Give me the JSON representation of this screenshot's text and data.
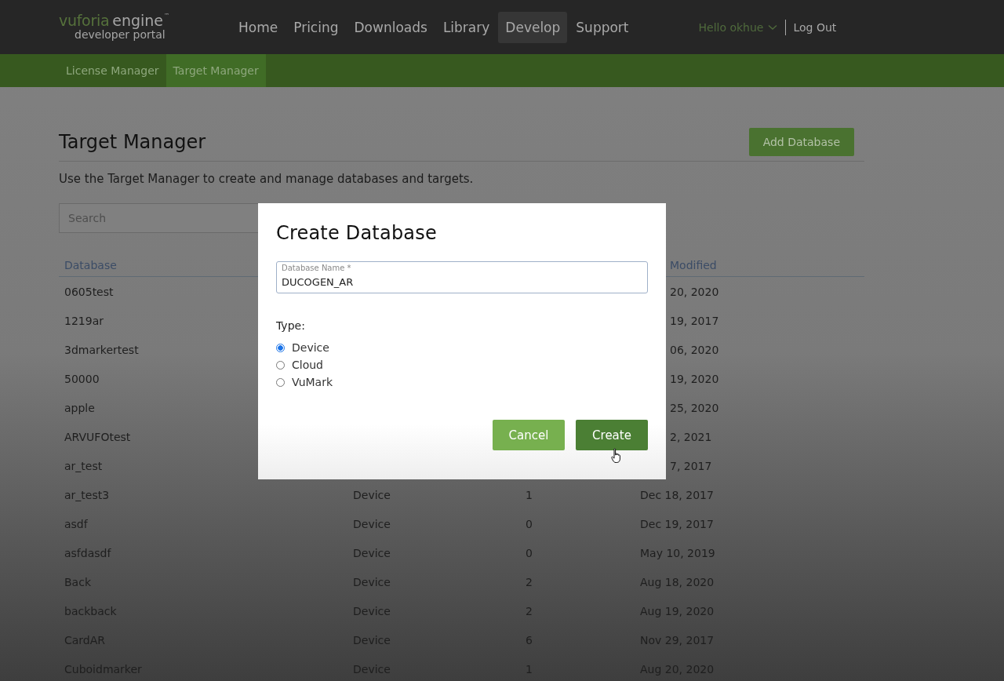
{
  "header": {
    "logo": {
      "brand": "vuforia",
      "product": "engine",
      "mark": "™",
      "subtitle": "developer portal"
    },
    "nav": [
      {
        "label": "Home",
        "selected": false
      },
      {
        "label": "Pricing",
        "selected": false
      },
      {
        "label": "Downloads",
        "selected": false
      },
      {
        "label": "Library",
        "selected": false
      },
      {
        "label": "Develop",
        "selected": true
      },
      {
        "label": "Support",
        "selected": false
      }
    ],
    "user": "Hello okhue",
    "logout": "Log Out"
  },
  "subnav": [
    {
      "label": "License Manager",
      "selected": false
    },
    {
      "label": "Target Manager",
      "selected": true
    }
  ],
  "page": {
    "title": "Target Manager",
    "add_button": "Add Database",
    "description": "Use the Target Manager to create and manage databases and targets.",
    "search": {
      "placeholder": "Search"
    }
  },
  "table": {
    "columns": [
      {
        "label": "Database",
        "covered": false
      },
      {
        "label": "Modified",
        "covered": true
      }
    ],
    "rows": [
      {
        "database": "0605test",
        "modified": "20, 2020"
      },
      {
        "database": "1219ar",
        "modified": "19, 2017"
      },
      {
        "database": "3dmarkertest",
        "modified": "06, 2020"
      },
      {
        "database": "50000",
        "modified": "19, 2020"
      },
      {
        "database": "apple",
        "modified": "25, 2020"
      },
      {
        "database": "ARVUFOtest",
        "modified": "2, 2021"
      },
      {
        "database": "ar_test",
        "modified": "7, 2017"
      },
      {
        "database": "ar_test3",
        "type": "Device",
        "targets": "1",
        "modified": "Dec 18, 2017"
      },
      {
        "database": "asdf",
        "type": "Device",
        "targets": "0",
        "modified": "Dec 19, 2017"
      },
      {
        "database": "asfdasdf",
        "type": "Device",
        "targets": "0",
        "modified": "May 10, 2019"
      },
      {
        "database": "Back",
        "type": "Device",
        "targets": "2",
        "modified": "Aug 18, 2020"
      },
      {
        "database": "backback",
        "type": "Device",
        "targets": "2",
        "modified": "Aug 19, 2020"
      },
      {
        "database": "CardAR",
        "type": "Device",
        "targets": "6",
        "modified": "Nov 29, 2017"
      },
      {
        "database": "Cuboidmarker",
        "type": "Device",
        "targets": "1",
        "modified": "Aug 20, 2020"
      }
    ]
  },
  "modal": {
    "title": "Create Database",
    "field": {
      "label": "Database Name *",
      "value": "DUCOGEN_AR"
    },
    "type_label": "Type:",
    "options": [
      {
        "label": "Device",
        "selected": true
      },
      {
        "label": "Cloud",
        "selected": false
      },
      {
        "label": "VuMark",
        "selected": false
      }
    ],
    "buttons": [
      {
        "label": "Cancel",
        "kind": "secondary"
      },
      {
        "label": "Create",
        "kind": "primary"
      }
    ]
  }
}
